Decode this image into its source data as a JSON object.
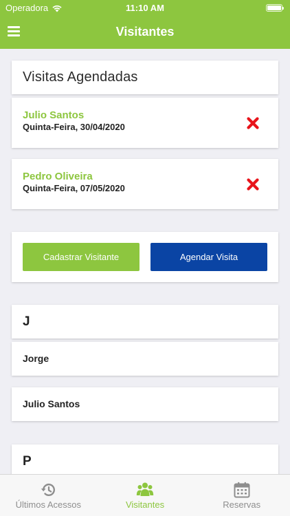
{
  "status_bar": {
    "carrier": "Operadora",
    "time": "11:10 AM"
  },
  "nav": {
    "title": "Visitantes",
    "menu_icon": "hamburger-menu-icon"
  },
  "scheduled": {
    "title": "Visitas Agendadas",
    "visits": [
      {
        "name": "Julio Santos",
        "date": "Quinta-Feira, 30/04/2020"
      },
      {
        "name": "Pedro Oliveira",
        "date": "Quinta-Feira, 07/05/2020"
      }
    ]
  },
  "actions": {
    "register_label": "Cadastrar Visitante",
    "schedule_label": "Agendar Visita"
  },
  "contacts": [
    {
      "letter": "J",
      "names": [
        "Jorge",
        "Julio Santos"
      ]
    },
    {
      "letter": "P",
      "names": []
    }
  ],
  "tabs": [
    {
      "label": "Últimos Acessos",
      "icon": "history-icon",
      "active": false
    },
    {
      "label": "Visitantes",
      "icon": "users-icon",
      "active": true
    },
    {
      "label": "Reservas",
      "icon": "calendar-icon",
      "active": false
    }
  ],
  "colors": {
    "brand_green": "#8dc63f",
    "primary_blue": "#0a44a4",
    "delete_red": "#e8141b",
    "inactive_gray": "#8e8e8e"
  }
}
